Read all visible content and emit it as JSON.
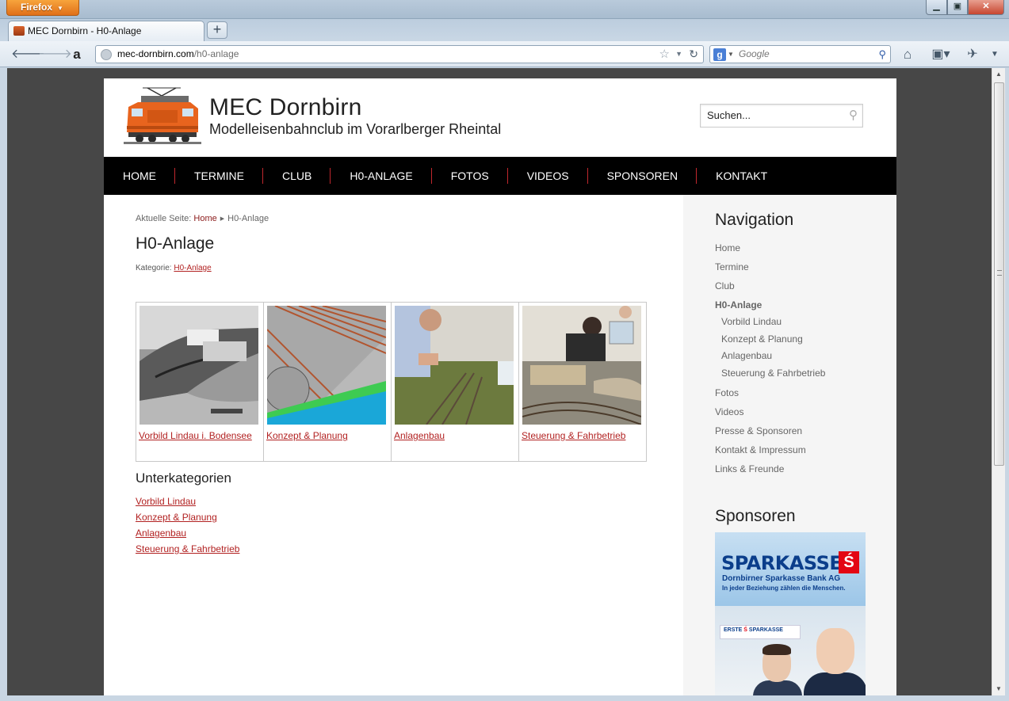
{
  "browser": {
    "menu_button": "Firefox",
    "tab_title": "MEC Dornbirn - H0-Anlage",
    "url_host": "mec-dornbirn.com",
    "url_path": "/h0-anlage",
    "search_placeholder": "Google",
    "search_engine_icon": "google-icon"
  },
  "header": {
    "title": "MEC Dornbirn",
    "subtitle": "Modelleisenbahnclub im Vorarlberger Rheintal",
    "search_placeholder": "Suchen..."
  },
  "mainmenu": [
    "HOME",
    "TERMINE",
    "CLUB",
    "H0-ANLAGE",
    "FOTOS",
    "VIDEOS",
    "SPONSOREN",
    "KONTAKT"
  ],
  "content": {
    "breadcrumb_prefix": "Aktuelle Seite:",
    "breadcrumb_home": "Home",
    "breadcrumb_current": "H0-Anlage",
    "heading": "H0-Anlage",
    "category_prefix": "Kategorie:",
    "category_link": "H0-Anlage",
    "gallery": [
      {
        "caption": "Vorbild Lindau i. Bodensee"
      },
      {
        "caption": "Konzept & Planung"
      },
      {
        "caption": "Anlagenbau"
      },
      {
        "caption": "Steuerung & Fahrbetrieb"
      }
    ],
    "subcategories_heading": "Unterkategorien",
    "subcategories": [
      "Vorbild Lindau",
      "Konzept & Planung",
      "Anlagenbau",
      "Steuerung & Fahrbetrieb"
    ]
  },
  "sidebar": {
    "nav_heading": "Navigation",
    "items": [
      "Home",
      "Termine",
      "Club"
    ],
    "active": "H0-Anlage",
    "subitems": [
      "Vorbild Lindau",
      "Konzept & Planung",
      "Anlagenbau",
      "Steuerung & Fahrbetrieb"
    ],
    "items_after": [
      "Fotos",
      "Videos",
      "Presse & Sponsoren",
      "Kontakt & Impressum",
      "Links & Freunde"
    ],
    "sponsors_heading": "Sponsoren",
    "ad": {
      "brand": "SPARKASSE",
      "brand_symbol": "Ś",
      "line1": "Dornbirner Sparkasse Bank AG",
      "line2": "In jeder Beziehung zählen die Menschen.",
      "mini_left": "ERSTE",
      "mini_right": "SPARKASSE"
    }
  },
  "colors": {
    "menu_bg": "#000000",
    "menu_divider": "#c0272d",
    "link": "#b22222",
    "sidebar_bg": "#f5f5f5"
  }
}
